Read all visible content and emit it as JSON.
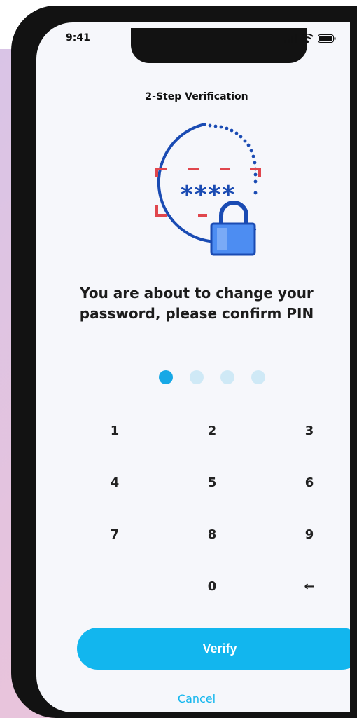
{
  "status_bar": {
    "time": "9:41"
  },
  "header": {
    "title": "2-Step Verification"
  },
  "illustration": {
    "masked_pin": "****",
    "icon_name": "lock-icon"
  },
  "message": "You are about to change your password, please confirm PIN",
  "pin_entry": {
    "length": 4,
    "filled": 1
  },
  "keypad": {
    "keys": [
      "1",
      "2",
      "3",
      "4",
      "5",
      "6",
      "7",
      "8",
      "9",
      "0",
      "←"
    ]
  },
  "actions": {
    "verify_label": "Verify",
    "cancel_label": "Cancel"
  },
  "colors": {
    "accent": "#12b6ee",
    "dot_active": "#17a8e6",
    "dot_inactive": "#cfe9f6",
    "illustration_blue": "#1a4bb3",
    "illustration_red": "#e0464d"
  }
}
